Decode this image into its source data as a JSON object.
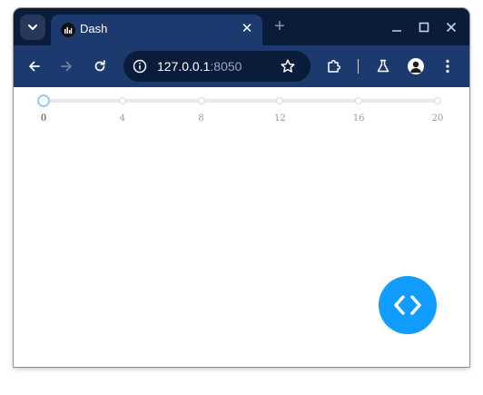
{
  "browser": {
    "tab_title": "Dash",
    "tab_close_glyph": "✕",
    "new_tab_glyph": "+",
    "url_host": "127.0.0.1",
    "url_port": ":8050",
    "icons": [
      "tab-search-icon",
      "dash-favicon-icon",
      "close-icon",
      "plus-icon",
      "minimize-icon",
      "maximize-icon",
      "window-close-icon",
      "back-arrow-icon",
      "forward-arrow-icon",
      "reload-icon",
      "site-info-icon",
      "star-icon",
      "extensions-icon",
      "labs-flask-icon",
      "profile-avatar-icon",
      "more-menu-icon"
    ],
    "colors": {
      "frame": "#0b1c3a",
      "toolbar": "#1c3a6e",
      "active_tab": "#1c3a6e"
    }
  },
  "slider": {
    "min": 0,
    "max": 20,
    "value": 0,
    "marks": [
      "0",
      "4",
      "8",
      "12",
      "16",
      "20"
    ],
    "colors": {
      "rail": "#e9e9e9",
      "handle_border": "#8fd0e8"
    }
  },
  "devtools": {
    "icon": "code-brackets-icon",
    "color": "#119dff"
  }
}
